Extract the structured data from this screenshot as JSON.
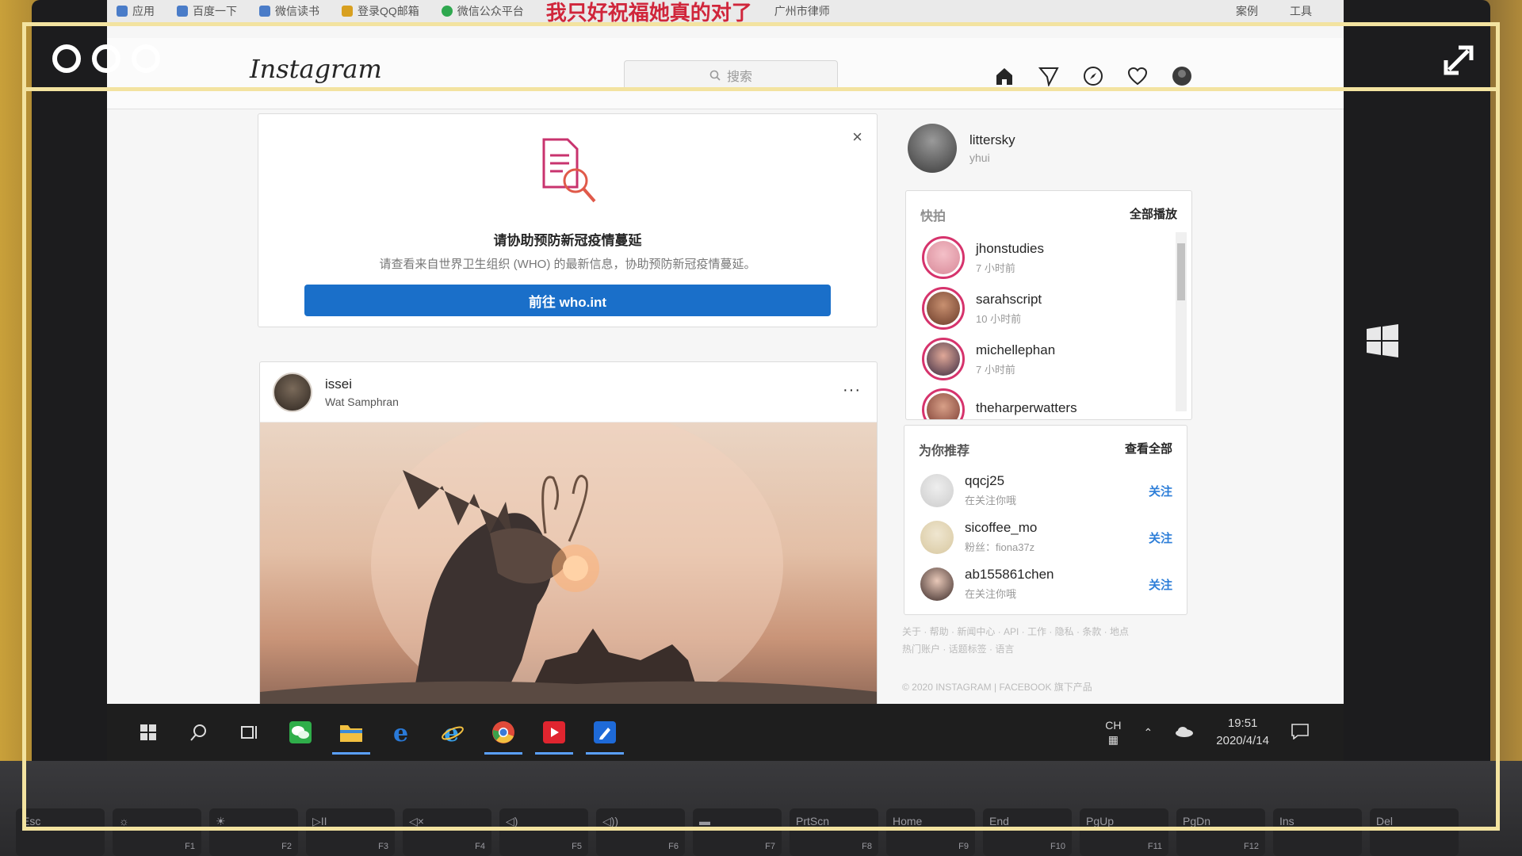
{
  "bookmarks": {
    "items": [
      "应用",
      "百度一下",
      "微信读书",
      "登录QQ邮箱",
      "微信公众平台",
      "广州市律师"
    ],
    "red_text": "我只好祝福她真的对了",
    "right": [
      "案例",
      "工具"
    ]
  },
  "header": {
    "logo": "Instagram",
    "search_placeholder": "搜索"
  },
  "covid": {
    "title": "请协助预防新冠疫情蔓延",
    "subtitle": "请查看来自世界卫生组织 (WHO) 的最新信息，协助预防新冠疫情蔓延。",
    "button": "前往 who.int",
    "close": "×"
  },
  "post": {
    "username": "issei",
    "location": "Wat Samphran",
    "more": "···"
  },
  "profile": {
    "username": "littersky",
    "fullname": "yhui"
  },
  "stories": {
    "title": "快拍",
    "watch_all": "全部播放",
    "items": [
      {
        "name": "jhonstudies",
        "time": "7 小时前"
      },
      {
        "name": "sarahscript",
        "time": "10 小时前"
      },
      {
        "name": "michellephan",
        "time": "7 小时前"
      },
      {
        "name": "theharperwatters",
        "time": ""
      }
    ]
  },
  "suggestions": {
    "title": "为你推荐",
    "see_all": "查看全部",
    "follow_label": "关注",
    "items": [
      {
        "name": "qqcj25",
        "sub": "在关注你哦"
      },
      {
        "name": "sicoffee_mo",
        "sub": "粉丝：fiona37z"
      },
      {
        "name": "ab155861chen",
        "sub": "在关注你哦"
      }
    ]
  },
  "footer": {
    "links": "关于 · 帮助 · 新闻中心 · API · 工作 · 隐私 · 条款 · 地点",
    "links2": "热门账户 · 话题标签 · 语言",
    "copyright": "© 2020 INSTAGRAM | FACEBOOK 旗下产品"
  },
  "taskbar": {
    "lang": "CH",
    "time": "19:51",
    "date": "2020/4/14"
  },
  "keyboard": {
    "keys": [
      {
        "label": "Esc",
        "fn": ""
      },
      {
        "label": "☼",
        "fn": "F1"
      },
      {
        "label": "☀",
        "fn": "F2"
      },
      {
        "label": "▷II",
        "fn": "F3"
      },
      {
        "label": "◁×",
        "fn": "F4"
      },
      {
        "label": "◁)",
        "fn": "F5"
      },
      {
        "label": "◁))",
        "fn": "F6"
      },
      {
        "label": "▬",
        "fn": "F7"
      },
      {
        "label": "PrtScn",
        "fn": "F8"
      },
      {
        "label": "Home",
        "fn": "F9"
      },
      {
        "label": "End",
        "fn": "F10"
      },
      {
        "label": "PgUp",
        "fn": "F11"
      },
      {
        "label": "PgDn",
        "fn": "F12"
      },
      {
        "label": "Ins",
        "fn": ""
      },
      {
        "label": "Del",
        "fn": ""
      }
    ]
  },
  "colors": {
    "accent_blue": "#1a6fc9",
    "story_ring": "#d6336c",
    "frame": "#f3e3a0"
  }
}
